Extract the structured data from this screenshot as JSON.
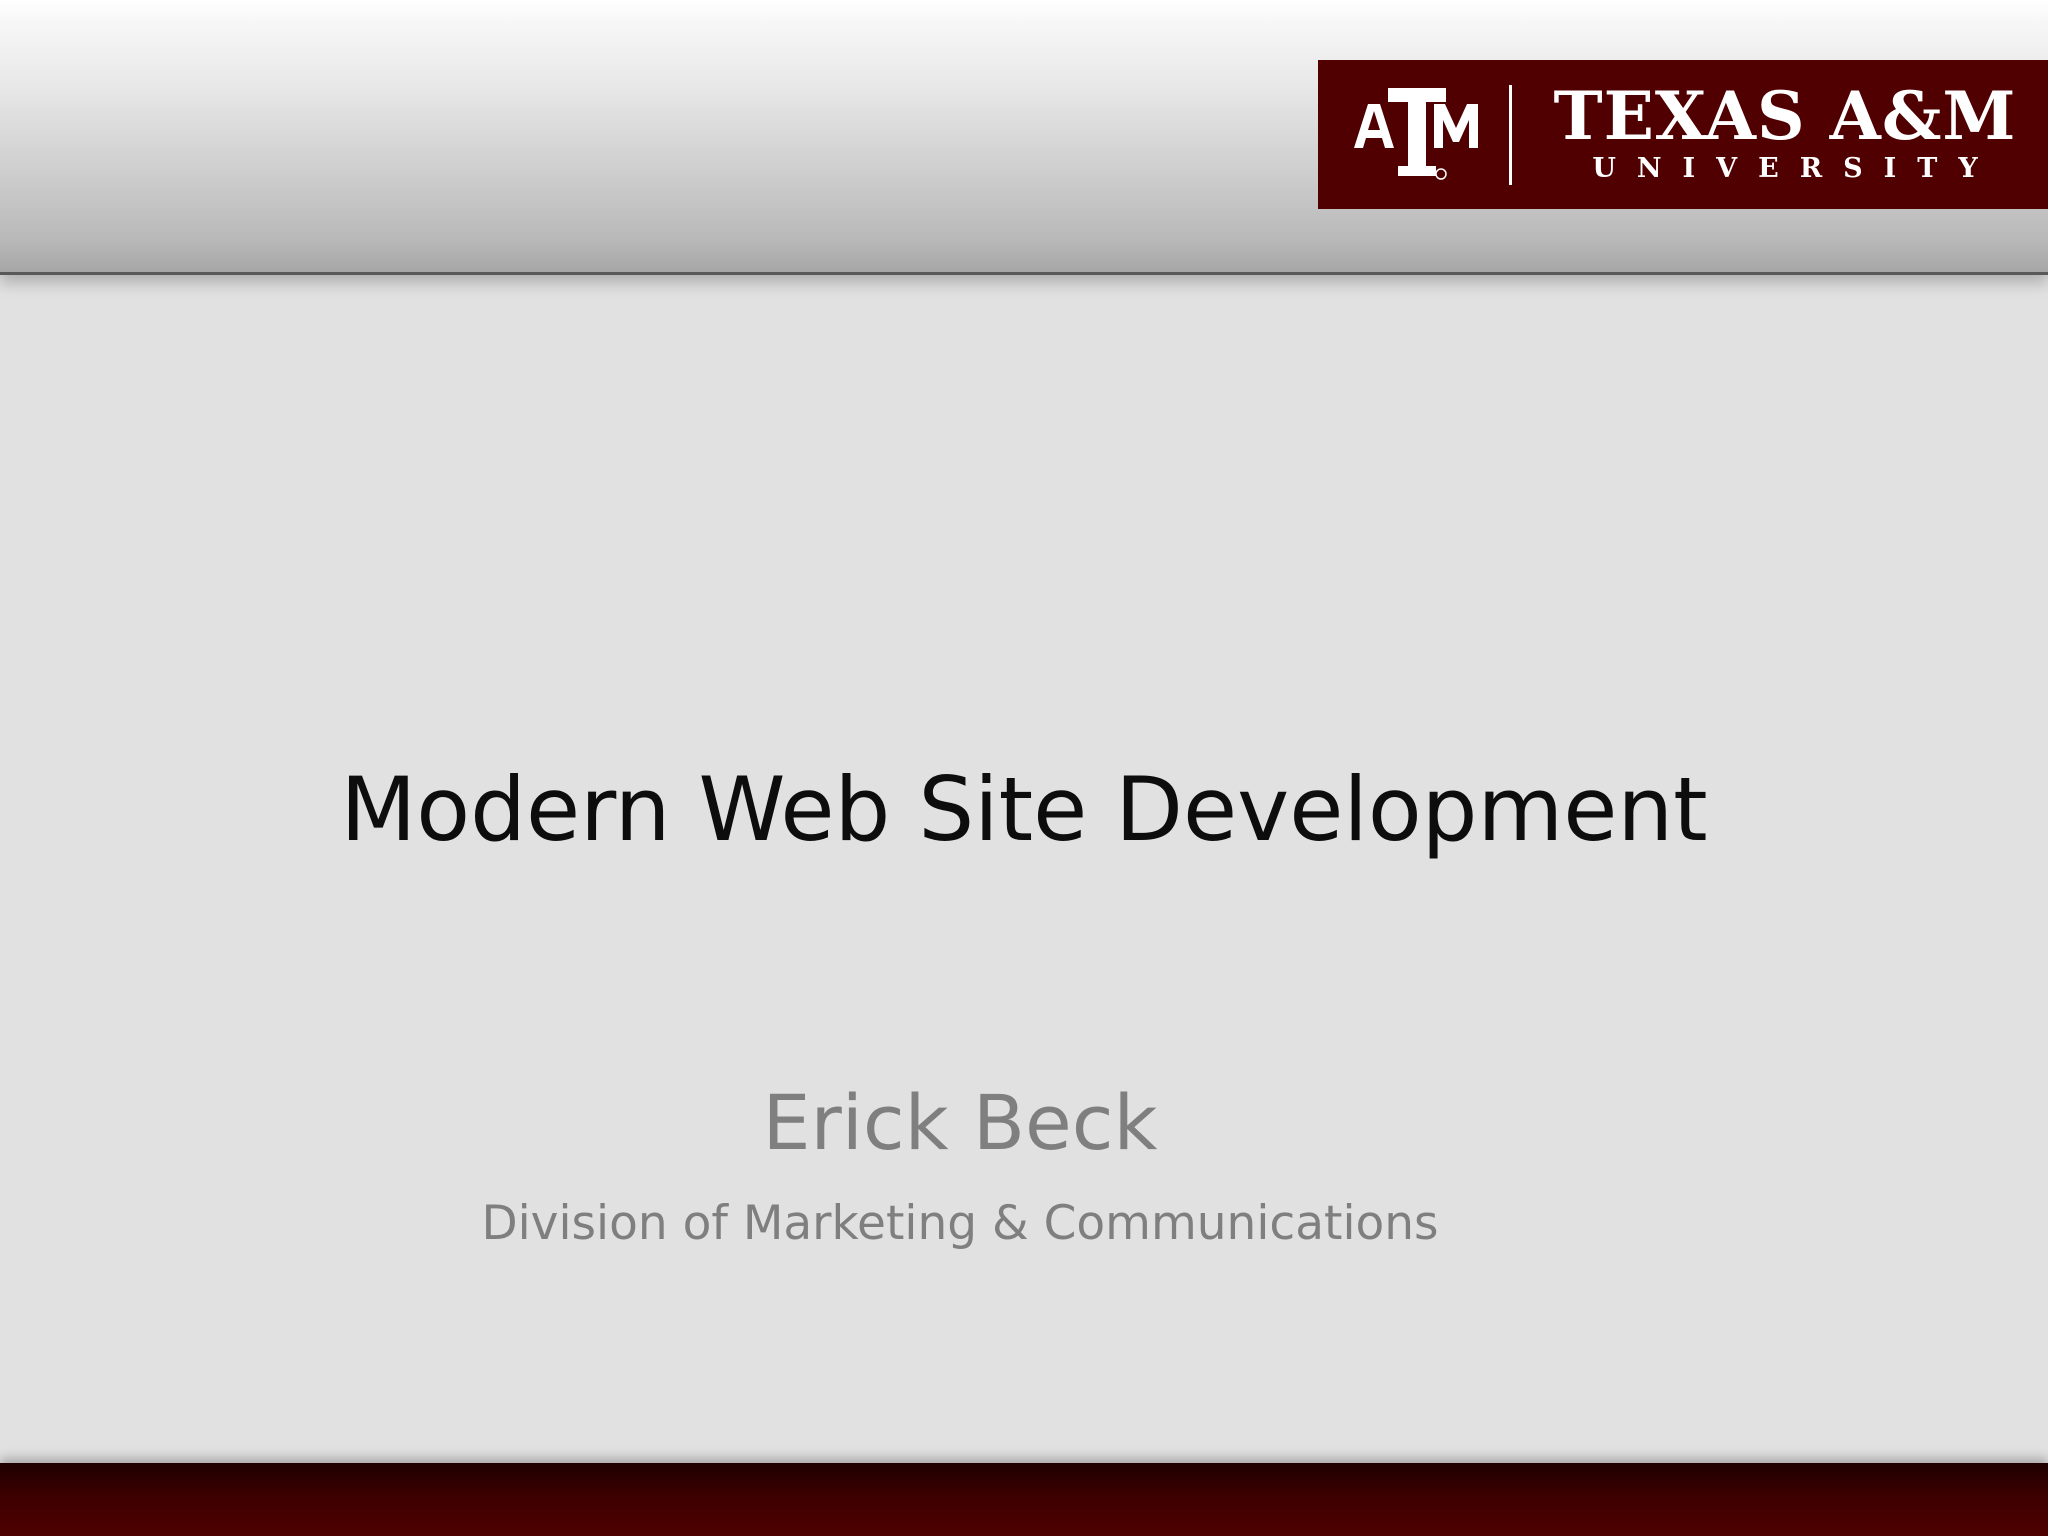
{
  "slide": {
    "title": "Modern Web Site Development",
    "presenter": "Erick Beck",
    "affiliation": "Division of Marketing & Communications"
  },
  "logo": {
    "name_line1": "TEXAS A&M",
    "name_line2": "UNIVERSITY",
    "mark": "ATM",
    "mark_icon": "texas-am-atm-logo-icon"
  },
  "colors": {
    "brand_maroon": "#500000",
    "background": "#e1e1e1",
    "title_text": "#0d0d0d",
    "subtitle_text": "#7f7f7f"
  }
}
